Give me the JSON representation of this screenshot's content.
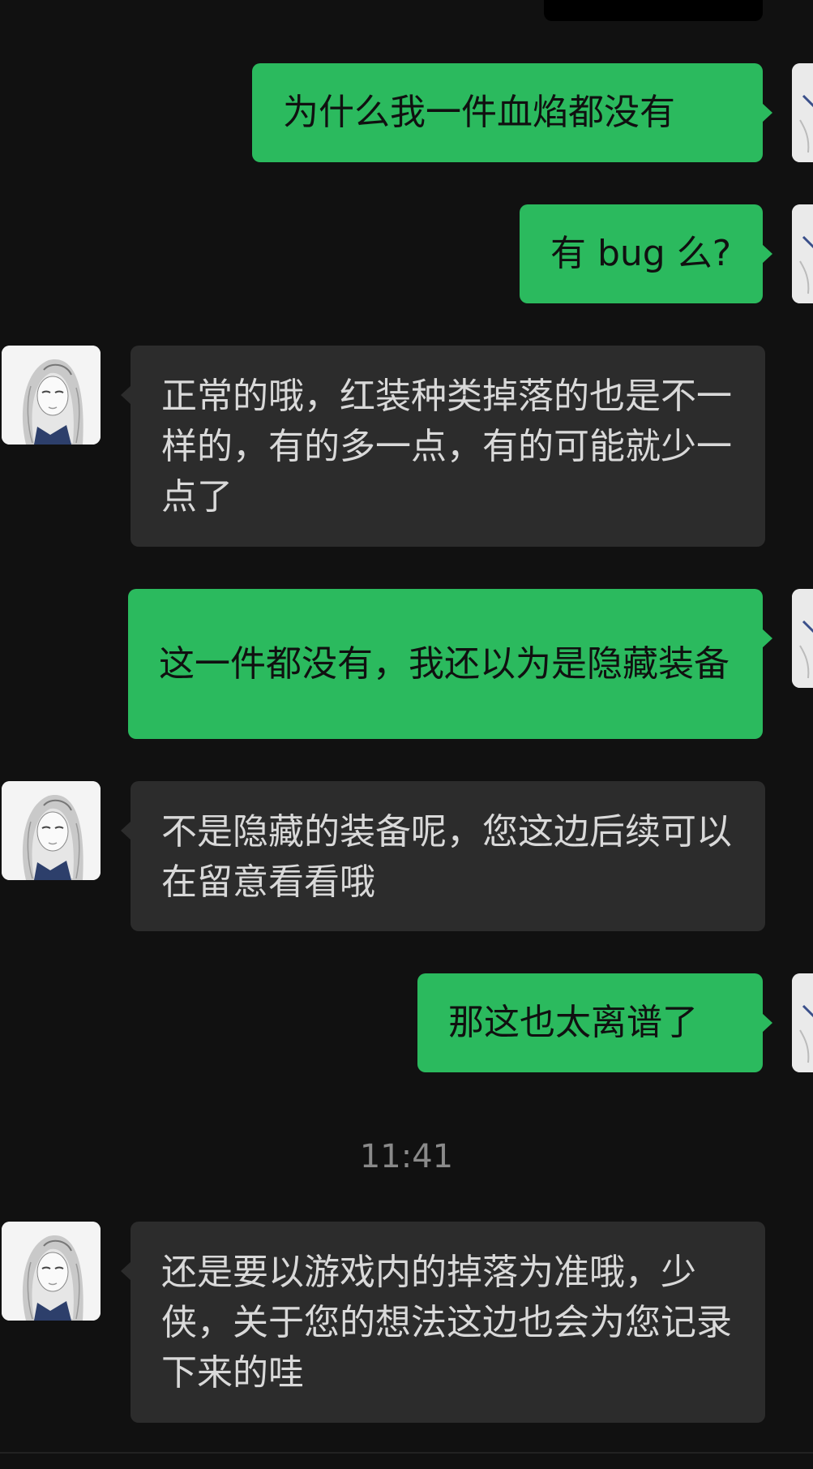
{
  "messages": [
    {
      "side": "out",
      "text": "为什么我一件血焰都没有"
    },
    {
      "side": "out",
      "text": "有 bug 么?"
    },
    {
      "side": "in",
      "text": "正常的哦，红装种类掉落的也是不一样的，有的多一点，有的可能就少一点了"
    },
    {
      "side": "out",
      "text": "这一件都没有，我还以为是隐藏装备"
    },
    {
      "side": "in",
      "text": "不是隐藏的装备呢，您这边后续可以在留意看看哦"
    },
    {
      "side": "out",
      "text": "那这也太离谱了"
    },
    {
      "side": "in",
      "text": "还是要以游戏内的掉落为准哦，少侠，关于您的想法这边也会为您记录下来的哇"
    }
  ],
  "timestamp": "11:41",
  "icons": {
    "agent_avatar": "anime-character-avatar-icon",
    "user_avatar": "user-avatar-icon"
  },
  "colors": {
    "background": "#111111",
    "outgoing_bubble": "#2bba5e",
    "incoming_bubble": "#2c2c2c",
    "incoming_text": "#d9d9d9",
    "timestamp_text": "#8a8a8a"
  }
}
